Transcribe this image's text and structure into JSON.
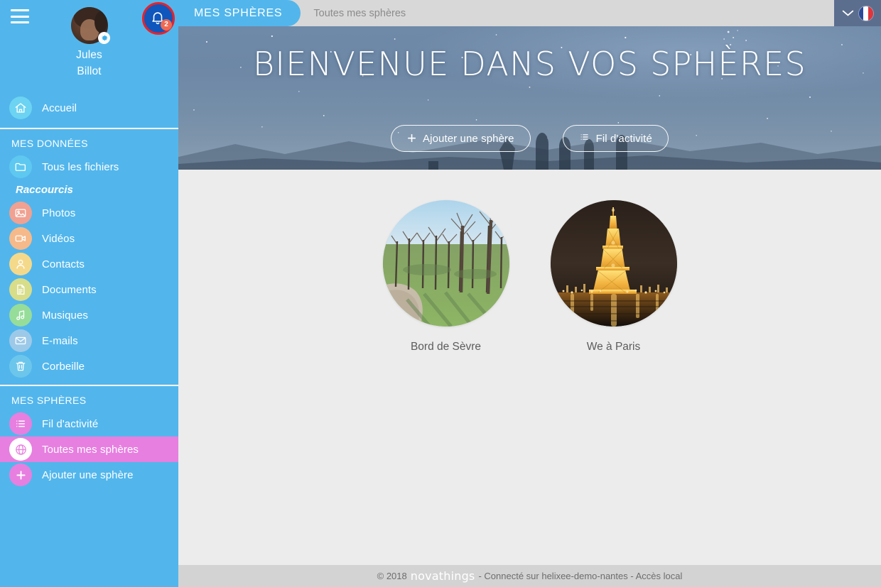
{
  "sidebar": {
    "menu_icon": "hamburger-icon",
    "user": {
      "first_name": "Jules",
      "last_name": "Billot",
      "settings_icon": "gear-icon",
      "avatar_icon": "avatar"
    },
    "notifications": {
      "icon": "bell-icon",
      "count": "2"
    },
    "home": {
      "label": "Accueil",
      "icon": "home-icon"
    },
    "sections": [
      {
        "title": "MES DONNÉES",
        "items": [
          {
            "label": "Tous les fichiers",
            "icon": "folder-icon",
            "color": "#5ec8f0"
          }
        ],
        "subtitle": "Raccourcis",
        "shortcuts": [
          {
            "label": "Photos",
            "icon": "photo-icon",
            "color": "#f0a191"
          },
          {
            "label": "Vidéos",
            "icon": "video-icon",
            "color": "#f6b98a"
          },
          {
            "label": "Contacts",
            "icon": "contact-icon",
            "color": "#f5d98a"
          },
          {
            "label": "Documents",
            "icon": "document-icon",
            "color": "#d8dd8a"
          },
          {
            "label": "Musiques",
            "icon": "music-icon",
            "color": "#96dd9a"
          },
          {
            "label": "E-mails",
            "icon": "mail-icon",
            "color": "#9dc9e8"
          },
          {
            "label": "Corbeille",
            "icon": "trash-icon",
            "color": "#6cc6ec"
          }
        ]
      },
      {
        "title": "MES SPHÈRES",
        "items": [
          {
            "label": "Fil d'activité",
            "icon": "list-icon",
            "color": "#e77fe0",
            "active": false
          },
          {
            "label": "Toutes mes sphères",
            "icon": "globe-icon",
            "color": "#ffffff",
            "active": true
          },
          {
            "label": "Ajouter une sphère",
            "icon": "plus-icon",
            "color": "#e77fe0",
            "active": false
          }
        ]
      }
    ]
  },
  "topbar": {
    "tab_label": "MES SPHÈRES",
    "breadcrumb": "Toutes mes sphères",
    "chevron_icon": "chevron-down-icon",
    "language_icon": "flag-fr-icon"
  },
  "hero": {
    "title": "BIENVENUE DANS VOS SPHÈRES",
    "buttons": [
      {
        "label": "Ajouter une sphère",
        "icon": "plus-icon"
      },
      {
        "label": "Fil d'activité",
        "icon": "list-icon"
      }
    ]
  },
  "spheres": [
    {
      "name": "Bord de Sèvre",
      "image": "park-path-trees-photo"
    },
    {
      "name": "We à Paris",
      "image": "eiffel-tower-night-photo"
    }
  ],
  "footer": {
    "copyright": "© 2018",
    "brand": "novathings",
    "status": "- Connecté sur helixee-demo-nantes - Accès local"
  },
  "colors": {
    "sidebar_blue": "#52b6ec",
    "accent_pink": "#e77fe0",
    "tab_blue": "#52b6ec",
    "topbar_gray": "#d8d8d8",
    "content_gray": "#ececec",
    "footer_gray": "#d3d3d3",
    "notification_red": "#e8222a",
    "badge_orange": "#ee6a52"
  }
}
